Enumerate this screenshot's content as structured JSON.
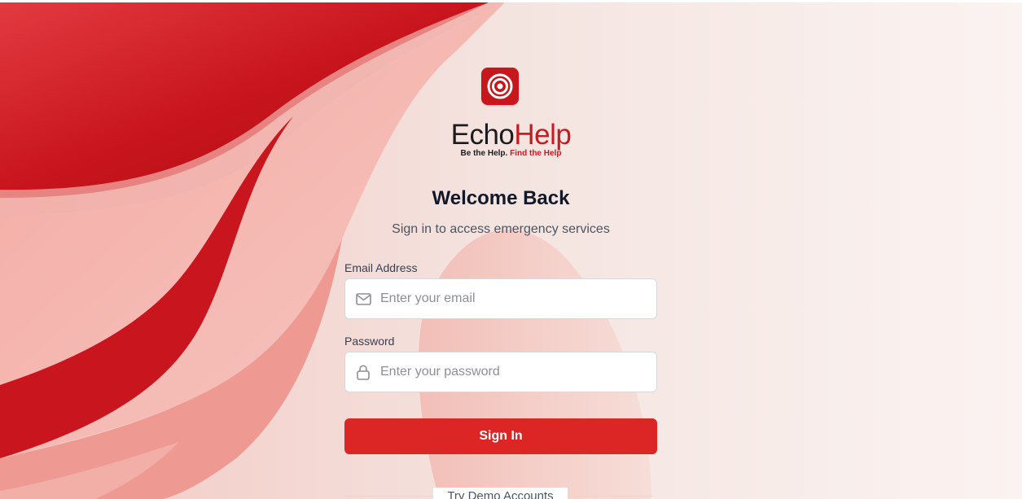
{
  "brand": {
    "name_part1": "Echo",
    "name_part2": "Help",
    "tagline_part1": "Be the Help.",
    "tagline_part2": "Find the Help",
    "logo_icon": "target-rings-icon",
    "accent_color": "#c81a22"
  },
  "login": {
    "title": "Welcome Back",
    "subtitle": "Sign in to access emergency services",
    "email": {
      "label": "Email Address",
      "placeholder": "Enter your email",
      "value": "",
      "icon": "mail-icon"
    },
    "password": {
      "label": "Password",
      "placeholder": "Enter your password",
      "value": "",
      "icon": "lock-icon"
    },
    "submit_label": "Sign In",
    "button_color": "#dc2626",
    "demo_label": "Try Demo Accounts"
  }
}
